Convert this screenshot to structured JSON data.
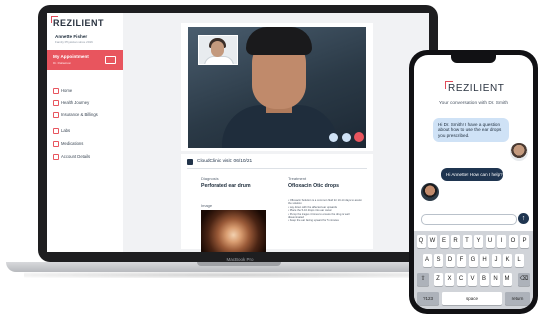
{
  "laptop": {
    "brand_label": "MacBook Pro",
    "sidebar": {
      "logo": "REZILIENT",
      "user_name": "Annette Fisher",
      "user_sub": "Family Physician since 2016",
      "appointment": {
        "label": "My Appointment",
        "sub": "Dr. Rafaelson"
      },
      "nav": [
        {
          "label": "Home",
          "icon": "home-icon"
        },
        {
          "label": "Health Journey",
          "icon": "heart-icon"
        },
        {
          "label": "Insurance & Billings",
          "icon": "card-icon"
        },
        {
          "label": "Labs",
          "icon": "flask-icon"
        },
        {
          "label": "Medications",
          "icon": "pill-icon"
        },
        {
          "label": "Account Details",
          "icon": "user-icon"
        }
      ]
    },
    "visit": {
      "title": "CloudClinic visit: 06/10/21",
      "diagnosis_label": "Diagnosis",
      "diagnosis": "Perforated ear drum",
      "treatment_label": "Treatment",
      "treatment": "Ofloxacin Otic drops",
      "treatment_note": "• Ofloxacin Solution is a common fluid for 10-14 days to assist the solution\n• Lay down with the affected ear upwards\n• Place the 5-10 drops into ear canal\n• Pump the tragus 4 times to ensure the drug is well disseminated\n• Keep the ear facing upward for 5 minutes",
      "image_label": "Image"
    },
    "video_controls": [
      {
        "name": "mic",
        "color": "#cfe2f6"
      },
      {
        "name": "camera",
        "color": "#cfe2f6"
      },
      {
        "name": "end-call",
        "color": "#e8555e"
      }
    ]
  },
  "phone": {
    "logo": "REZILIENT",
    "conversation_title": "Your conversation with Dr. Smith",
    "messages": [
      {
        "from": "patient",
        "text": "Hi Dr. Smith! I have a question about how to use the ear drops you prescribed."
      },
      {
        "from": "doctor",
        "text": "Hi Annette! How can I help?"
      }
    ],
    "keyboard": {
      "row1": [
        "Q",
        "W",
        "E",
        "R",
        "T",
        "Y",
        "U",
        "I",
        "O",
        "P"
      ],
      "row2": [
        "A",
        "S",
        "D",
        "F",
        "G",
        "H",
        "J",
        "K",
        "L"
      ],
      "row3": [
        "Z",
        "X",
        "C",
        "V",
        "B",
        "N",
        "M"
      ],
      "num_key": "?123",
      "space_key": "space",
      "return_key": "return"
    }
  },
  "colors": {
    "accent": "#e8555e",
    "navy": "#1f3550",
    "bubble": "#cfe2f6"
  }
}
